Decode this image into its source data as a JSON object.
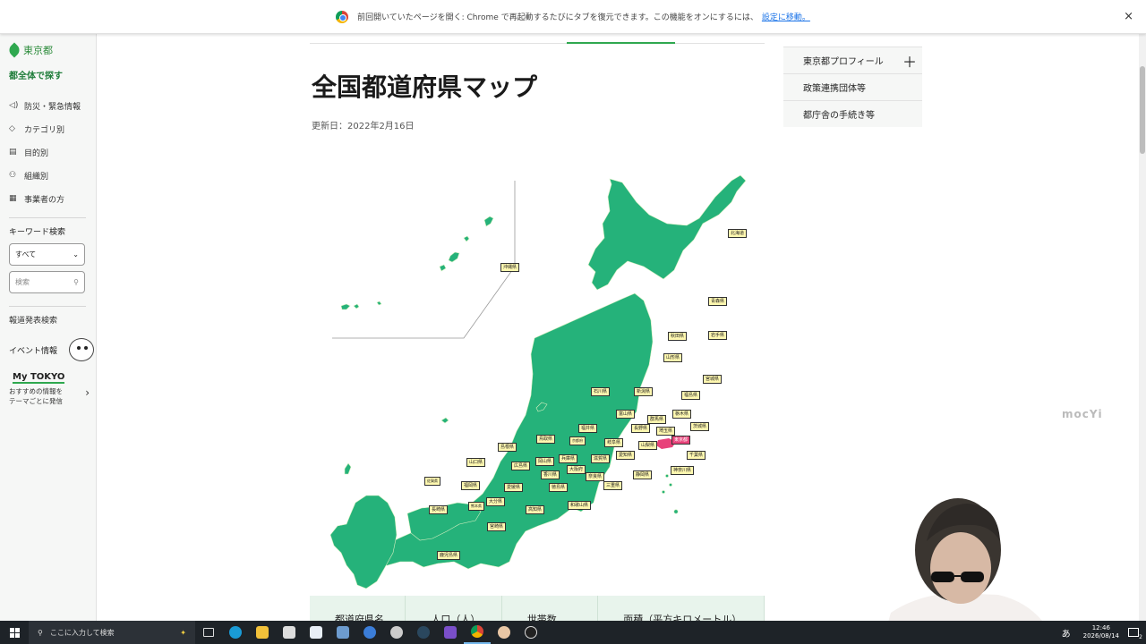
{
  "notification_bar": {
    "message": "前回開いていたページを開く: Chrome で再起動するたびにタブを復元できます。この機能をオンにするには、",
    "link": "設定に移動。",
    "close": "×"
  },
  "sidebar": {
    "logo_text": "東京都",
    "heading": "都全体で探す",
    "items": [
      {
        "label": "防災・緊急情報",
        "icon": "speaker-icon",
        "glyph": "◁)"
      },
      {
        "label": "カテゴリ別",
        "icon": "tag-icon",
        "glyph": "◇"
      },
      {
        "label": "目的別",
        "icon": "document-icon",
        "glyph": "▤"
      },
      {
        "label": "組織別",
        "icon": "org-icon",
        "glyph": "⚇"
      },
      {
        "label": "事業者の方",
        "icon": "building-icon",
        "glyph": "▦"
      }
    ],
    "keyword_label": "キーワード検索",
    "select_value": "すべて",
    "search_placeholder": "検索",
    "press_link": "報道発表検索",
    "event_link": "イベント情報",
    "mytokyo_title": "My TOKYO",
    "mytokyo_desc_1": "おすすめの情報を",
    "mytokyo_desc_2": "テーマごとに発信"
  },
  "main": {
    "title": "全国都道府県マップ",
    "updated": "更新日：2022年2月16日",
    "table_headers": [
      "都道府県名",
      "人口（人）",
      "世帯数",
      "面積（平方キロメートル）"
    ]
  },
  "right_nav": {
    "items": [
      {
        "label": "東京都プロフィール",
        "plus": "＋"
      },
      {
        "label": "政策連携団体等"
      },
      {
        "label": "都庁舎の手続き等"
      }
    ]
  },
  "map": {
    "land_color": "#25b27a",
    "highlight_color": "#e8427a",
    "labels": [
      "北海道",
      "青森県",
      "岩手県",
      "秋田県",
      "山形県",
      "宮城県",
      "福島県",
      "新潟県",
      "石川県",
      "富山県",
      "栃木県",
      "群馬県",
      "茨城県",
      "長野県",
      "埼玉県",
      "福井県",
      "東京都",
      "千葉県",
      "神奈川県",
      "岐阜県",
      "山梨県",
      "愛知県",
      "静岡県",
      "滋賀県",
      "京都府",
      "兵庫県",
      "大阪府",
      "奈良県",
      "三重県",
      "和歌山県",
      "鳥取県",
      "岡山県",
      "島根県",
      "広島県",
      "山口県",
      "香川県",
      "徳島県",
      "愛媛県",
      "高知県",
      "福岡県",
      "佐賀県",
      "長崎県",
      "熊本県",
      "大分県",
      "宮崎県",
      "鹿児島県",
      "沖縄県"
    ]
  },
  "watermark": "mocYi",
  "taskbar": {
    "search_placeholder": "ここに入力して検索",
    "ime": "あ",
    "time": "12:46",
    "date": "2026/08/14"
  }
}
